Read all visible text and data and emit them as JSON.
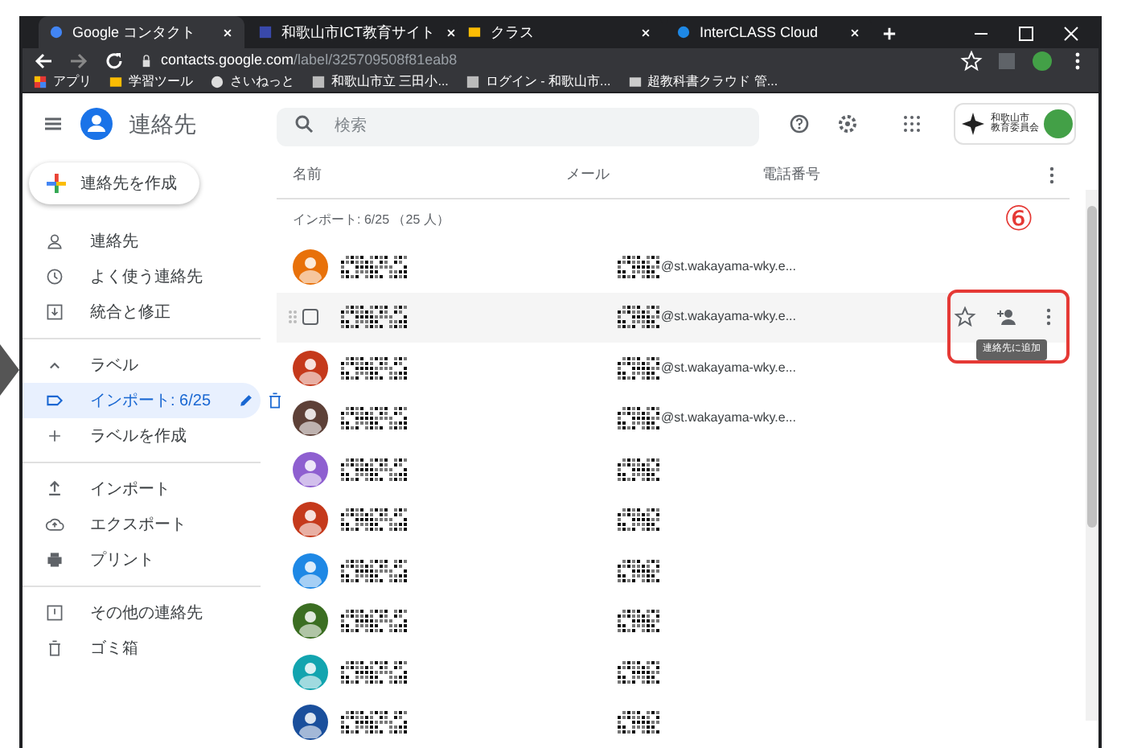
{
  "browser": {
    "tabs": [
      {
        "label": "Google コンタクト",
        "selected": true
      },
      {
        "label": "和歌山市ICT教育サイト",
        "selected": false
      },
      {
        "label": "クラス",
        "selected": false
      },
      {
        "label": "InterCLASS Cloud",
        "selected": false
      }
    ],
    "url_host": "contacts.google.com",
    "url_path": "/label/325709508f81eab8",
    "bookmarks": [
      "アプリ",
      "学習ツール",
      "さいねっと",
      "和歌山市立 三田小...",
      "ログイン - 和歌山市...",
      "超教科書クラウド 管..."
    ]
  },
  "app": {
    "title": "連絡先",
    "create_button": "連絡先を作成",
    "search": {
      "placeholder": "検索"
    },
    "org_logo": [
      "和歌山市",
      "教育委員会"
    ]
  },
  "sidebar": {
    "sections": [
      {
        "items": [
          {
            "label": "連絡先",
            "selected": false
          },
          {
            "label": "よく使う連絡先",
            "selected": false
          },
          {
            "label": "統合と修正",
            "selected": false
          }
        ]
      },
      {
        "items": [
          {
            "kind": "header",
            "label": "ラベル",
            "selected": false,
            "expanded": true
          },
          {
            "kind": "label",
            "label": "インポート: 6/25",
            "selected": true
          },
          {
            "kind": "create",
            "label": "ラベルを作成",
            "selected": false
          }
        ]
      },
      {
        "items": [
          {
            "label": "インポート",
            "selected": false
          },
          {
            "label": "エクスポート",
            "selected": false
          },
          {
            "label": "プリント",
            "selected": false
          }
        ]
      },
      {
        "items": [
          {
            "label": "その他の連絡先",
            "selected": false
          },
          {
            "label": "ゴミ箱",
            "selected": false
          }
        ]
      }
    ]
  },
  "table": {
    "columns": [
      "名前",
      "メール",
      "電話番号"
    ],
    "group_label": "インポート: 6/25 （25 人）",
    "rows": [
      {
        "color": "#e8710a",
        "email": "@st.wakayama-wky.e...",
        "hovered": false
      },
      {
        "email": "@st.wakayama-wky.e...",
        "hovered": true,
        "row_tooltip": "連絡先に追加"
      },
      {
        "color": "#c5391b",
        "email": "@st.wakayama-wky.e...",
        "hovered": false
      },
      {
        "color": "#5d4037",
        "email": "@st.wakayama-wky.e...",
        "hovered": false
      },
      {
        "color": "#8e5fd0",
        "hovered": false
      },
      {
        "color": "#c5391b",
        "hovered": false
      },
      {
        "color": "#1e88e5",
        "hovered": false
      },
      {
        "color": "#3b6e22",
        "hovered": false
      },
      {
        "color": "#12a4af",
        "hovered": false
      },
      {
        "color": "#1a4f9c",
        "hovered": false
      }
    ]
  },
  "annotation": {
    "label": "⑥"
  }
}
